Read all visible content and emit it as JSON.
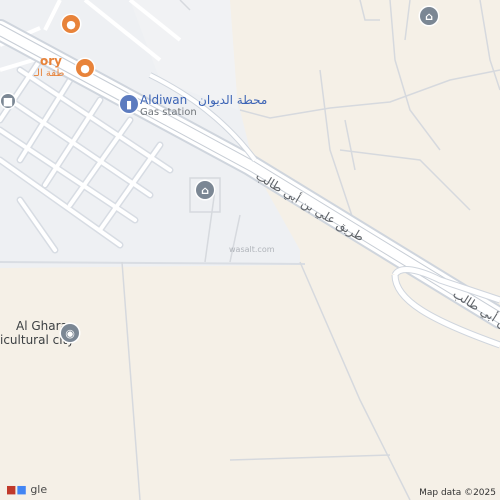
{
  "map": {
    "pois": {
      "factory_partial": "ory",
      "factory_arabic_partial": "طقة الـ",
      "gas_station_en": "Aldiwan",
      "gas_station_ar": "محطة الديوان",
      "gas_station_type": "Gas station",
      "agri_city_line1": "Al Ghara",
      "agri_city_line2": "icultural city",
      "watermark": "wasalt.com"
    },
    "roads": {
      "main_road_ar": "طريق علي بن أبي طالب",
      "main_road_ar_partial": "بن أبي طالب"
    },
    "footer": {
      "google_logo_partial": "gle",
      "credit": "Map data ©2025"
    },
    "colors": {
      "land": "#f5f0e7",
      "urban": "#eef0f3",
      "road_fill": "#ffffff",
      "road_edge": "#cfd5dd",
      "poi_orange": "#e8833a",
      "poi_blue": "#5c7bbf",
      "poi_gray": "#7b8794"
    },
    "icons": [
      "restaurant-icon",
      "fuel-icon",
      "mosque-icon",
      "landmark-icon",
      "transit-icon"
    ]
  }
}
